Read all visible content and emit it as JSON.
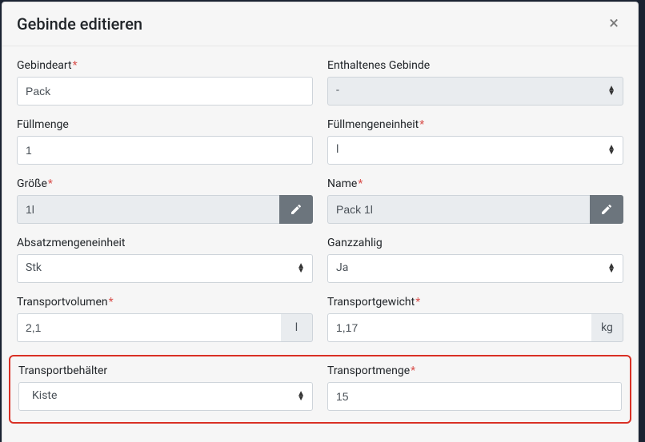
{
  "modal": {
    "title": "Gebinde editieren"
  },
  "fields": {
    "gebindeart": {
      "label": "Gebindeart",
      "required": true,
      "value": "Pack"
    },
    "enthaltenes": {
      "label": "Enthaltenes Gebinde",
      "value": "-"
    },
    "fuellmenge": {
      "label": "Füllmenge",
      "value": "1"
    },
    "fuellmengeneinheit": {
      "label": "Füllmengeneinheit",
      "required": true,
      "value": "l"
    },
    "groesse": {
      "label": "Größe",
      "required": true,
      "value": "1l"
    },
    "name": {
      "label": "Name",
      "required": true,
      "value": "Pack 1l"
    },
    "absatzmengeneinheit": {
      "label": "Absatzmengeneinheit",
      "value": "Stk"
    },
    "ganzzahlig": {
      "label": "Ganzzahlig",
      "value": "Ja"
    },
    "transportvolumen": {
      "label": "Transportvolumen",
      "required": true,
      "value": "2,1",
      "unit": "l"
    },
    "transportgewicht": {
      "label": "Transportgewicht",
      "required": true,
      "value": "1,17",
      "unit": "kg"
    },
    "transportbehaelter": {
      "label": "Transportbehälter",
      "value": "Kiste"
    },
    "transportmenge": {
      "label": "Transportmenge",
      "required": true,
      "value": "15"
    }
  }
}
